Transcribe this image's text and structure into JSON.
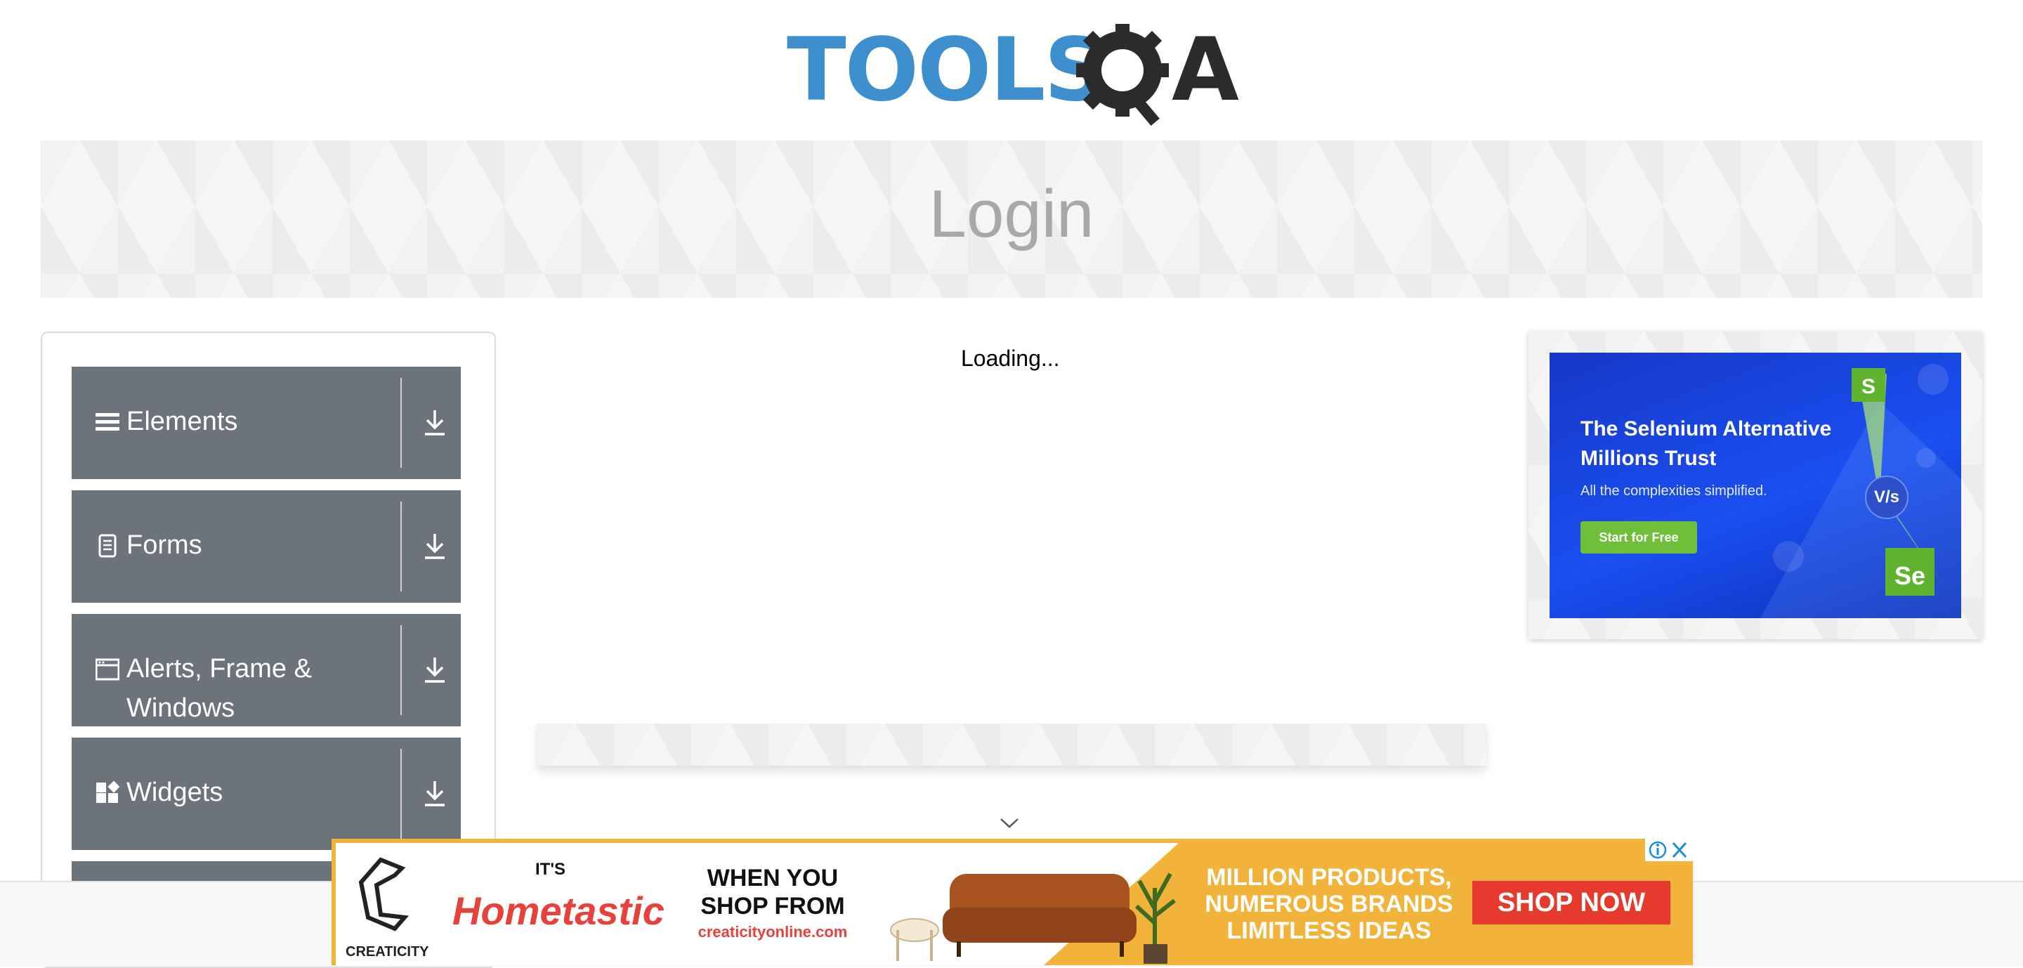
{
  "logo": {
    "text": "TOOLS",
    "suffix": "A",
    "accent": "#3d8fce"
  },
  "banner": {
    "title": "Login"
  },
  "sidebar": {
    "groups": [
      {
        "label": "Elements",
        "icon": "hamburger-icon"
      },
      {
        "label": "Forms",
        "icon": "document-icon"
      },
      {
        "label": "Alerts, Frame & Windows",
        "icon": "window-icon"
      },
      {
        "label": "Widgets",
        "icon": "widgets-icon"
      }
    ]
  },
  "main": {
    "loading": "Loading..."
  },
  "right_ad": {
    "headline": "The Selenium Alternative Millions Trust",
    "sub": "All the complexities simplified.",
    "button": "Start for Free",
    "vs": "V/s",
    "bg": "#1a4ff0"
  },
  "bottom_ad": {
    "brand": "CREATICITY",
    "its": "IT'S",
    "hometastic": "Hometastic",
    "when": "WHEN YOU SHOP FROM",
    "site": "creaticityonline.com",
    "tagline": "MILLION PRODUCTS, NUMEROUS BRANDS LIMITLESS IDEAS",
    "button": "SHOP NOW",
    "accent": "#f2b33a"
  }
}
